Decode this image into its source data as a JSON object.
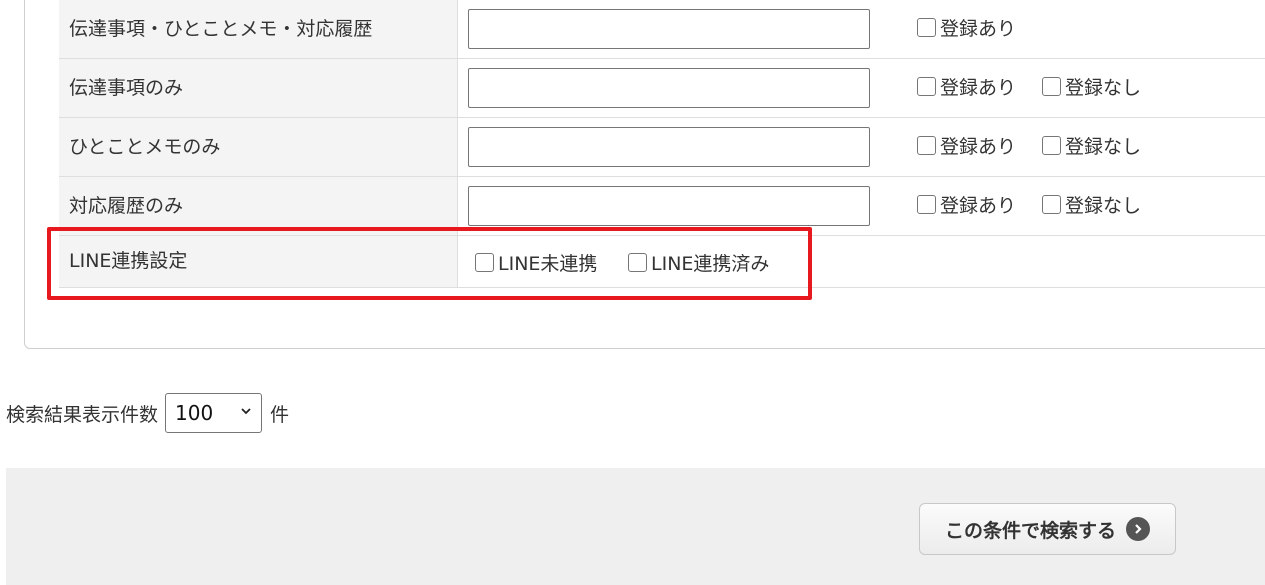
{
  "rows": [
    {
      "label": "伝達事項・ひとことメモ・対応履歴",
      "checks": [
        "登録あり"
      ]
    },
    {
      "label": "伝達事項のみ",
      "checks": [
        "登録あり",
        "登録なし"
      ]
    },
    {
      "label": "ひとことメモのみ",
      "checks": [
        "登録あり",
        "登録なし"
      ]
    },
    {
      "label": "対応履歴のみ",
      "checks": [
        "登録あり",
        "登録なし"
      ]
    }
  ],
  "line_row": {
    "label": "LINE連携設定",
    "checks": [
      "LINE未連携",
      "LINE連携済み"
    ]
  },
  "result_count": {
    "label": "検索結果表示件数",
    "selected": "100",
    "unit": "件"
  },
  "search_button": {
    "label": "この条件で検索する",
    "icon": "arrow-right-circle-icon"
  },
  "colors": {
    "highlight": "#e8191e",
    "label_bg": "#f4f4f4",
    "footer_bg": "#efefef"
  }
}
